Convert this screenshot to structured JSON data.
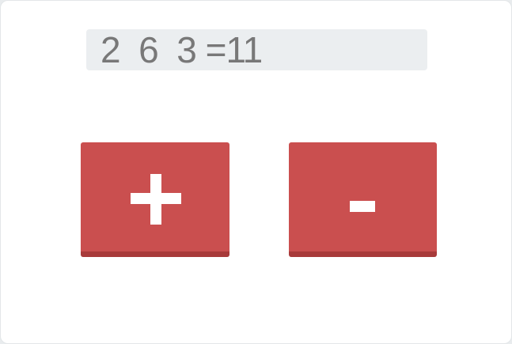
{
  "display": {
    "expression": "2  6  3 =11"
  },
  "buttons": {
    "plus_symbol": "+",
    "minus_symbol": "-"
  },
  "colors": {
    "button": "#ca4f4f",
    "button_shadow": "#a83a3a",
    "display_bg": "#ebeef0",
    "display_text": "#787878"
  }
}
